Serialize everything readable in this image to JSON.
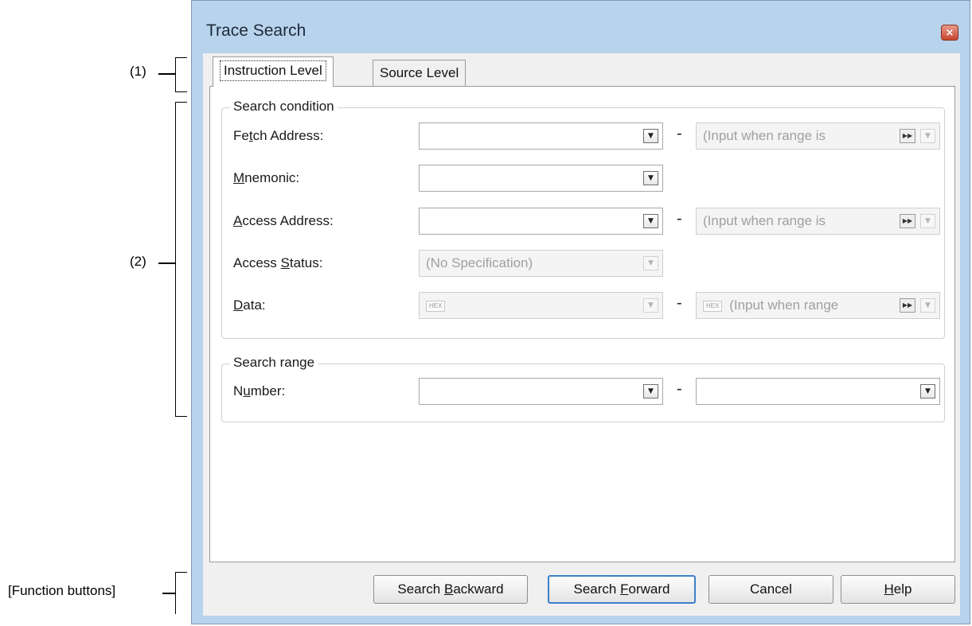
{
  "callouts": {
    "tabs": "(1)",
    "panel": "(2)",
    "buttons": "[Function buttons]"
  },
  "window": {
    "title": "Trace Search",
    "close_glyph": "×"
  },
  "tabs": [
    {
      "label": "Instruction Level",
      "active": true
    },
    {
      "label": "Source Level",
      "active": false
    }
  ],
  "search_condition": {
    "group_label": "Search condition",
    "rows": {
      "fetch_address": {
        "label": "Fetch Address:",
        "value": "",
        "range_placeholder": "(Input when range is"
      },
      "mnemonic": {
        "label": "Mnemonic:",
        "value": ""
      },
      "access_address": {
        "label": "Access Address:",
        "value": "",
        "range_placeholder": "(Input when range is"
      },
      "access_status": {
        "label": "Access Status:",
        "value": "(No Specification)"
      },
      "data": {
        "label": "Data:",
        "hex_badge": "HEX",
        "value": "",
        "range_placeholder": "(Input when range"
      }
    }
  },
  "search_range": {
    "group_label": "Search range",
    "number": {
      "label": "Number:",
      "from": "",
      "to": ""
    }
  },
  "range_separator": "-",
  "buttons": {
    "search_backward": "Search Backward",
    "search_forward": "Search Forward",
    "cancel": "Cancel",
    "help": "Help"
  },
  "icons": {
    "dropdown": "chevron-down-icon",
    "fast_forward": "fast-forward-icon",
    "close": "close-icon"
  },
  "colors": {
    "window_frame": "#b8d3ec",
    "close_button": "#c9462f",
    "default_button_border": "#3d7fc9"
  }
}
